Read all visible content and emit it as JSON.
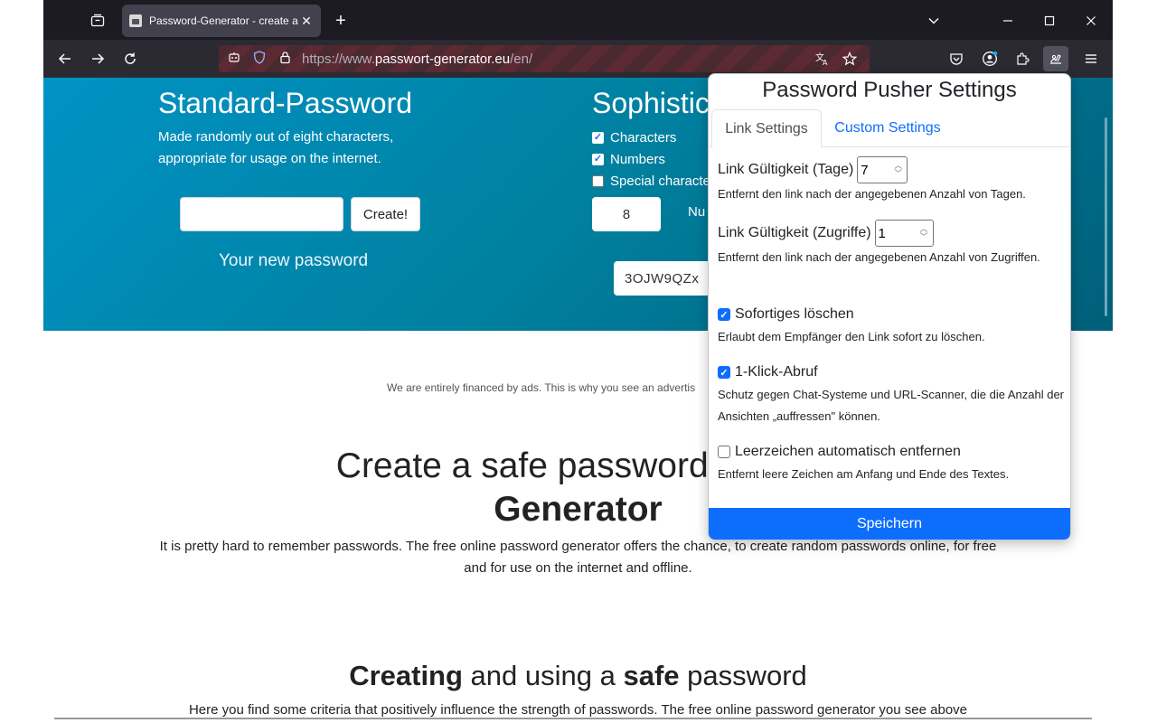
{
  "browser": {
    "tab_title": "Password-Generator - create a s",
    "tab_close": "✕",
    "new_tab": "+",
    "url_prefix": "https://www.",
    "url_domain": "passwort-generator.eu",
    "url_path": "/en/"
  },
  "page": {
    "standard_title": "Standard-Password",
    "standard_desc": "Made randomly out of eight characters, appropriate for usage on the internet.",
    "create_label": "Create!",
    "your_new_password": "Your new password",
    "soph_title": "Sophistic",
    "opt_characters": "Characters",
    "opt_numbers": "Numbers",
    "opt_special": "Special characte",
    "length_value": "8",
    "nu_label": "Nu",
    "soph_result": "3OJW9QZx",
    "ads_text": "We are entirely financed by ads. This is why you see an advertis",
    "h1_line1": "Create a safe password with th",
    "h1_line2": "Generator",
    "intro": "It is pretty hard to remember passwords. The free online password generator offers the chance, to create random passwords online, for free and for use on the internet and offline.",
    "h2_b1": "Creating",
    "h2_mid": " and using a ",
    "h2_b2": "safe",
    "h2_end": " password",
    "criteria": "Here you find some criteria that positively influence the strength of passwords. The free online password generator you see above"
  },
  "popup": {
    "title": "Password Pusher Settings",
    "tab_link": "Link Settings",
    "tab_custom": "Custom Settings",
    "days_label": "Link Gültigkeit (Tage)",
    "days_value": "7",
    "days_help": "Entfernt den link nach der angegebenen Anzahl von Tagen.",
    "views_label": "Link Gültigkeit (Zugriffe)",
    "views_value": "1",
    "views_help": "Entfernt den link nach der angegebenen Anzahl von Zugriffen.",
    "delete_label": "Sofortiges löschen",
    "delete_help": "Erlaubt dem Empfänger den Link sofort zu löschen.",
    "oneclick_label": "1-Klick-Abruf",
    "oneclick_help": "Schutz gegen Chat-Systeme und URL-Scanner, die die Anzahl der Ansichten „auffressen\" können.",
    "trim_label": "Leerzeichen automatisch entfernen",
    "trim_help": "Entfernt leere Zeichen am Anfang und Ende des Textes.",
    "save_label": "Speichern"
  }
}
